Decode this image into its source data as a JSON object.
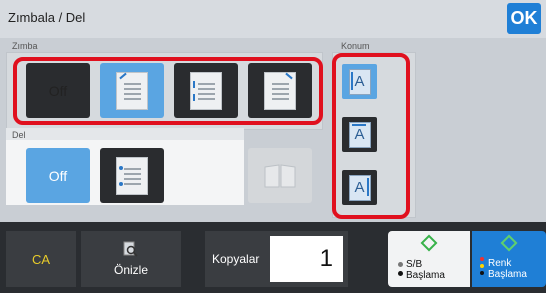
{
  "header": {
    "title": "Zımbala / Del",
    "ok_label": "OK"
  },
  "staple_section": {
    "label": "Zımba",
    "options": [
      {
        "label": "Off",
        "icon": "off",
        "selected": false
      },
      {
        "label": "",
        "icon": "staple-one-corner",
        "selected": true
      },
      {
        "label": "",
        "icon": "staple-two-left",
        "selected": false
      },
      {
        "label": "",
        "icon": "staple-one-corner-alt",
        "selected": false
      }
    ]
  },
  "punch_section": {
    "label": "Del",
    "options": [
      {
        "label": "Off",
        "icon": "off",
        "selected": true
      },
      {
        "label": "",
        "icon": "punch-two-holes",
        "selected": false
      }
    ],
    "disabled_icon": "booklet-icon"
  },
  "position_section": {
    "label": "Konum",
    "options": [
      {
        "letter": "A",
        "icon": "position-left",
        "selected": true
      },
      {
        "letter": "A",
        "icon": "position-top",
        "selected": false
      },
      {
        "letter": "A",
        "icon": "position-right",
        "selected": false
      }
    ]
  },
  "bottom_bar": {
    "ca_label": "CA",
    "preview_label": "Önizle",
    "copies_label": "Kopyalar",
    "copies_value": "1",
    "bw_start_label": [
      "S/B",
      "Başlama"
    ],
    "color_start_label": [
      "Renk",
      "Başlama"
    ]
  },
  "colors": {
    "accent_blue": "#1f7fd6",
    "selected_tile": "#5aa5e2",
    "highlight_red": "#e0101e",
    "ca_yellow": "#e8cc2a",
    "start_green": "#38b24a"
  }
}
